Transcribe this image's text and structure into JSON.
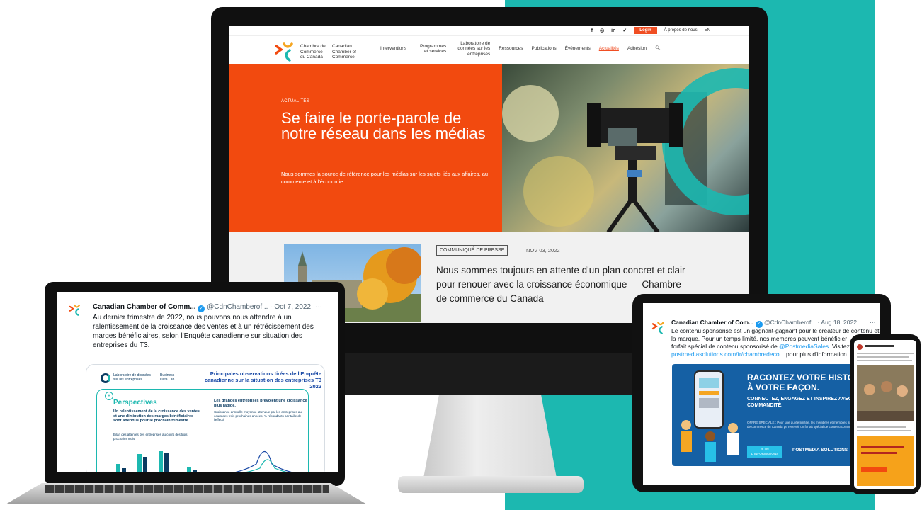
{
  "monitor": {
    "utility": {
      "social_icons": [
        "f",
        "◎",
        "in",
        "✓"
      ],
      "login": "Login",
      "about": "À propos de nous",
      "lang": "EN"
    },
    "logo": {
      "fr": [
        "Chambre de",
        "Commerce",
        "du Canada"
      ],
      "en": [
        "Canadian",
        "Chamber of",
        "Commerce"
      ]
    },
    "nav": [
      {
        "label": "Interventions",
        "active": false
      },
      {
        "label": "Programmes et services",
        "active": false
      },
      {
        "label": "Laboratoire de données sur les entreprises",
        "active": false
      },
      {
        "label": "Ressources",
        "active": false
      },
      {
        "label": "Publications",
        "active": false
      },
      {
        "label": "Événements",
        "active": false
      },
      {
        "label": "Actualités",
        "active": true
      },
      {
        "label": "Adhésion",
        "active": false
      }
    ],
    "hero": {
      "kicker": "ACTUALITÉS",
      "title": "Se faire le porte-parole de notre réseau dans les médias",
      "subtitle": "Nous sommes la source de référence pour les médias sur les sujets liés aux affaires, au commerce et à l'économie."
    },
    "news": {
      "tag": "COMMUNIQUÉ DE PRESSE",
      "date": "NOV 03, 2022",
      "title": "Nous sommes toujours en attente d'un plan concret et clair pour renouer avec la croissance économique — Chambre de commerce du Canada"
    }
  },
  "laptop": {
    "name": "Canadian Chamber of Comm...",
    "handle": "@CdnChamberof...",
    "date": "· Oct 7, 2022",
    "more": "···",
    "text": "Au dernier trimestre de 2022, nous pouvons nous attendre à un ralentissement de la croissance des ventes et à un rétrécissement des marges bénéficiaires, selon l'Enquête canadienne sur situation des entreprises du T3.",
    "infographic": {
      "lab_fr": [
        "Laboratoire de données",
        "sur les entreprises"
      ],
      "lab_en": [
        "Business",
        "Data Lab"
      ],
      "title": "Principales observations tirées de l'Enquête canadienne sur la situation des entreprises T3 2022",
      "plus": "+",
      "section": "Perspectives",
      "lead": "Un ralentissement de la croissance des ventes et une diminution des marges bénéficiaires sont attendus pour le prochain trimestre.",
      "bilan": "Bilan des attentes des entreprises au cours des trois prochains mois",
      "right_head": "Les grandes entreprises prévoient une croissance plus rapide.",
      "right_sub": "Croissance annuelle moyenne attendue par les entreprises au cours des trois prochaines années, % répondants par taille de l'effectif"
    }
  },
  "tablet": {
    "name": "Canadian Chamber of Com...",
    "handle": "@CdnChamberof...",
    "date": "· Aug 18, 2022",
    "more": "···",
    "line1": "Le contenu sponsorisé est un gagnant-gagnant pour le créateur de contenu et la marque. Pour un temps limité, nos membres peuvent bénéficier",
    "line2_pre": "forfait spécial de contenu sponsorisé de ",
    "mention": "@PostmediaSales",
    "line2_post": ". Visitez",
    "link": "postmediasolutions.com/fr/chambredeco...",
    "line3_post": " pour plus d'information",
    "ad": {
      "h1": "RACONTEZ VOTRE HISTOIRE.",
      "h1b": "À VOTRE FAÇON.",
      "h2": "CONNECTEZ, ENGAGEZ ET INSPIREZ AVEC DU CONTENU COMMANDITÉ.",
      "small": "OFFRE SPÉCIALE : Pour une durée limitée, les membres et membres affiliés de la Chambre de commerce du Canada pe recevoir un forfait spécial de contenu commandité.",
      "button": "PLUS D'INFORMATIONS",
      "brand": "POSTMEDIA SOLUTIONS"
    }
  },
  "colors": {
    "orange": "#f24a0f",
    "teal": "#1cb8b0",
    "navy": "#0b3b61",
    "twitter_blue": "#1d9bf0"
  }
}
